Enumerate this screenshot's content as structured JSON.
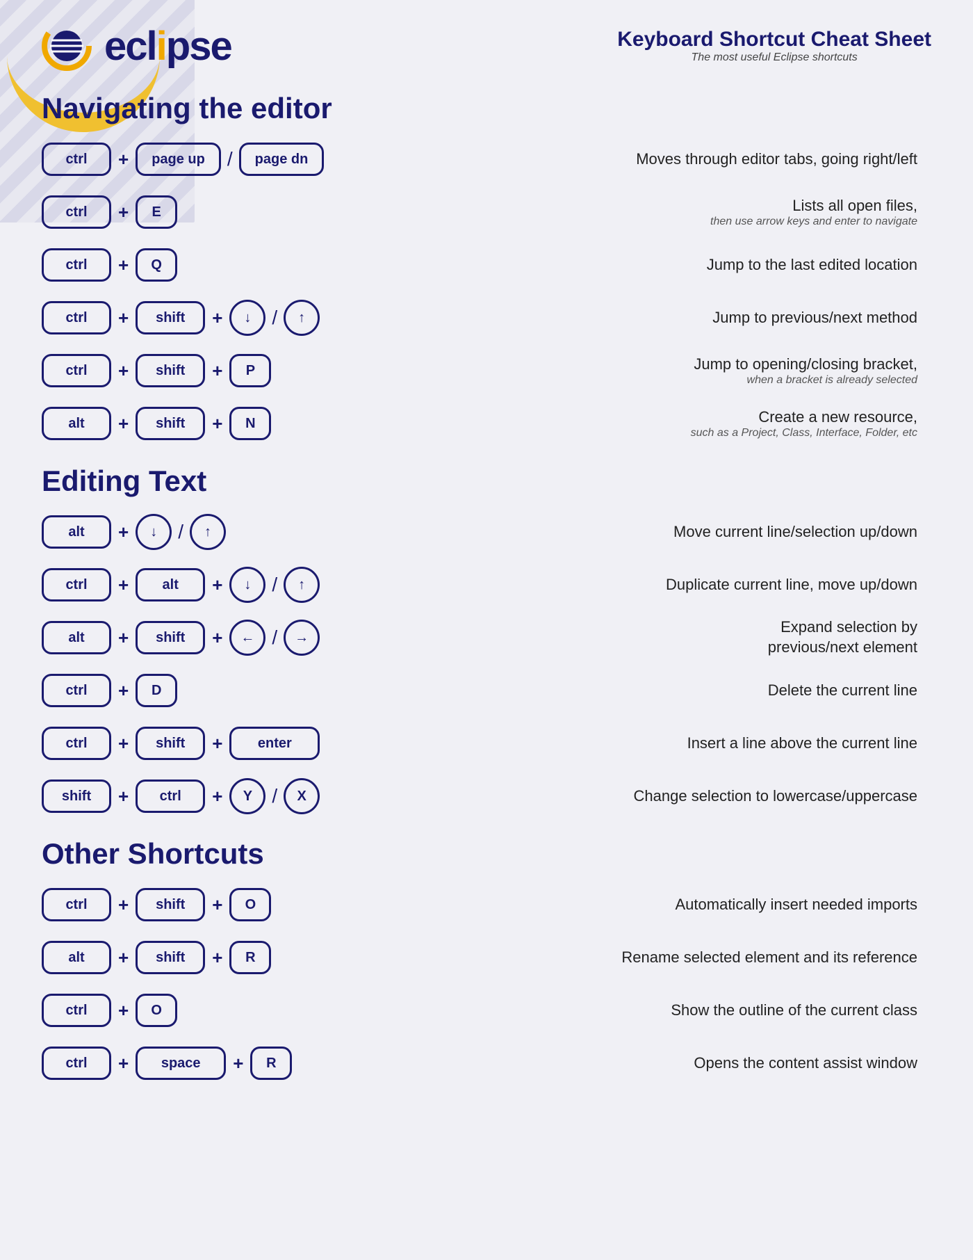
{
  "logo": {
    "text_before": "ecl",
    "text_highlight": "i",
    "text_after": "pse"
  },
  "header": {
    "title": "Keyboard Shortcut Cheat Sheet",
    "subtitle": "The most useful Eclipse shortcuts"
  },
  "sections": [
    {
      "id": "navigating",
      "title": "Navigating the editor",
      "shortcuts": [
        {
          "keys": [
            [
              "ctrl"
            ],
            "+",
            [
              "page up"
            ],
            "/",
            [
              "page dn"
            ]
          ],
          "desc": "Moves through editor tabs, going right/left",
          "desc_sub": ""
        },
        {
          "keys": [
            [
              "ctrl"
            ],
            "+",
            [
              "E"
            ]
          ],
          "desc": "Lists all open files,",
          "desc_sub": "then use arrow keys and enter to navigate"
        },
        {
          "keys": [
            [
              "ctrl"
            ],
            "+",
            [
              "Q"
            ]
          ],
          "desc": "Jump to the last edited location",
          "desc_sub": ""
        },
        {
          "keys": [
            [
              "ctrl"
            ],
            "+",
            [
              "shift"
            ],
            "+",
            [
              "↓"
            ],
            "/",
            [
              "↑"
            ]
          ],
          "desc": "Jump to previous/next method",
          "desc_sub": ""
        },
        {
          "keys": [
            [
              "ctrl"
            ],
            "+",
            [
              "shift"
            ],
            "+",
            [
              "P"
            ]
          ],
          "desc": "Jump to opening/closing bracket,",
          "desc_sub": "when a bracket is already selected"
        },
        {
          "keys": [
            [
              "alt"
            ],
            "+",
            [
              "shift"
            ],
            "+",
            [
              "N"
            ]
          ],
          "desc": "Create a new resource,",
          "desc_sub": "such as a Project, Class, Interface, Folder, etc"
        }
      ]
    },
    {
      "id": "editing",
      "title": "Editing Text",
      "shortcuts": [
        {
          "keys": [
            [
              "alt"
            ],
            "+",
            [
              "↓"
            ],
            "/",
            [
              "↑"
            ]
          ],
          "desc": "Move current line/selection up/down",
          "desc_sub": ""
        },
        {
          "keys": [
            [
              "ctrl"
            ],
            "+",
            [
              "alt"
            ],
            "+",
            [
              "↓"
            ],
            "/",
            [
              "↑"
            ]
          ],
          "desc": "Duplicate current line, move up/down",
          "desc_sub": ""
        },
        {
          "keys": [
            [
              "alt"
            ],
            "+",
            [
              "shift"
            ],
            "+",
            [
              "←"
            ],
            "/",
            [
              "→"
            ]
          ],
          "desc": "Expand selection by previous/next element",
          "desc_sub": ""
        },
        {
          "keys": [
            [
              "ctrl"
            ],
            "+",
            [
              "D"
            ]
          ],
          "desc": "Delete the current line",
          "desc_sub": ""
        },
        {
          "keys": [
            [
              "ctrl"
            ],
            "+",
            [
              "shift"
            ],
            "+",
            [
              "enter"
            ]
          ],
          "desc": "Insert a line above the current line",
          "desc_sub": ""
        },
        {
          "keys": [
            [
              "shift"
            ],
            "+",
            [
              "ctrl"
            ],
            "+",
            [
              "Y"
            ],
            "/",
            [
              "X"
            ]
          ],
          "desc": "Change selection to lowercase/uppercase",
          "desc_sub": ""
        }
      ]
    },
    {
      "id": "other",
      "title": "Other Shortcuts",
      "shortcuts": [
        {
          "keys": [
            [
              "ctrl"
            ],
            "+",
            [
              "shift"
            ],
            "+",
            [
              "O"
            ]
          ],
          "desc": "Automatically insert needed imports",
          "desc_sub": ""
        },
        {
          "keys": [
            [
              "alt"
            ],
            "+",
            [
              "shift"
            ],
            "+",
            [
              "R"
            ]
          ],
          "desc": "Rename selected element and its reference",
          "desc_sub": ""
        },
        {
          "keys": [
            [
              "ctrl"
            ],
            "+",
            [
              "O"
            ]
          ],
          "desc": "Show the outline of the current class",
          "desc_sub": ""
        },
        {
          "keys": [
            [
              "ctrl"
            ],
            "+",
            [
              "space"
            ],
            "+",
            [
              "R"
            ]
          ],
          "desc": "Opens the content assist window",
          "desc_sub": ""
        }
      ]
    }
  ]
}
